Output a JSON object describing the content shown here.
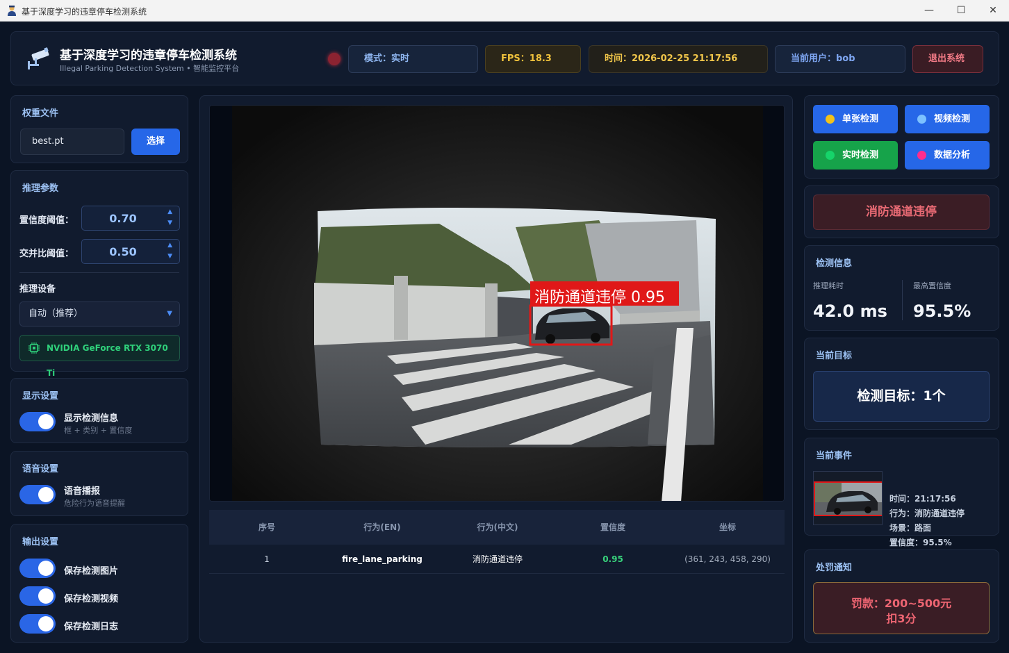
{
  "window": {
    "title": "基于深度学习的违章停车检测系统",
    "minimize": "—",
    "maximize": "☐",
    "close": "✕"
  },
  "header": {
    "title": "基于深度学习的违章停车检测系统",
    "subtitle": "Illegal Parking Detection System • 智能监控平台",
    "mode": "模式：实时",
    "fps": "FPS：18.3",
    "time": "时间：2026-02-25 21:17:56",
    "user": "当前用户：bob",
    "logout": "退出系统",
    "status_color": "#8c2331"
  },
  "weights": {
    "title": "权重文件",
    "file": "best.pt",
    "select_label": "选择"
  },
  "inference": {
    "title": "推理参数",
    "conf_label": "置信度阈值：",
    "conf_value": "0.70",
    "iou_label": "交并比阈值：",
    "iou_value": "0.50",
    "device_title": "推理设备",
    "device_value": "自动（推荐）",
    "gpu": "NVIDIA GeForce RTX 3070 Ti"
  },
  "display": {
    "title": "显示设置",
    "toggle_label": "显示检测信息",
    "toggle_desc": "框 + 类别 + 置信度",
    "on": true
  },
  "voice": {
    "title": "语音设置",
    "toggle_label": "语音播报",
    "toggle_desc": "危险行为语音提醒",
    "on": true
  },
  "output": {
    "title": "输出设置",
    "save_image": "保存检测图片",
    "save_video": "保存检测视频",
    "save_log": "保存检测日志"
  },
  "video": {
    "detection_label": "消防通道违停 0.95",
    "box_color": "#e01818"
  },
  "table": {
    "headers": [
      "序号",
      "行为(EN)",
      "行为(中文)",
      "置信度",
      "坐标"
    ],
    "rows": [
      [
        "1",
        "fire_lane_parking",
        "消防通道违停",
        "0.95",
        "(361, 243, 458, 290)"
      ]
    ]
  },
  "modes": {
    "single": "单张检测",
    "video": "视频检测",
    "realtime": "实时检测",
    "analysis": "数据分析",
    "colors": {
      "single_dot": "#f2c21b",
      "video_dot": "#7cc1ff",
      "realtime_dot": "#16d46a",
      "analysis_dot": "#ff2d8d",
      "blue": "#2667e8",
      "green": "#16a34a"
    }
  },
  "alert": {
    "text": "消防通道违停"
  },
  "detection_info": {
    "title": "检测信息",
    "time_label": "推理耗时",
    "time_value": "42.0 ms",
    "max_label": "最高置信度",
    "max_value": "95.5%"
  },
  "target": {
    "title": "当前目标",
    "value": "检测目标：1个"
  },
  "event": {
    "title": "当前事件",
    "time": "时间：21:17:56",
    "behavior": "行为：消防通道违停",
    "scene": "场景：路面",
    "confidence": "置信度：95.5%"
  },
  "penalty": {
    "title": "处罚通知",
    "fine": "罚款：200~500元",
    "points": "扣3分"
  }
}
